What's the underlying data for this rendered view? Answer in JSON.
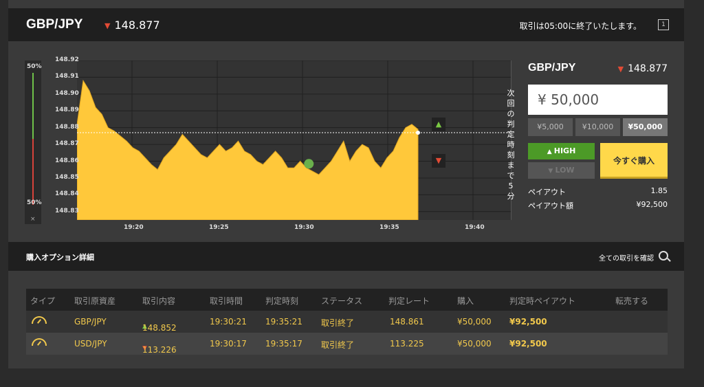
{
  "header": {
    "pair": "GBP/JPY",
    "rate": "148.877",
    "notice": "取引は05:00に終了いたします。",
    "corner_icon": "1"
  },
  "sidebar_bar": {
    "top_pct": "50%",
    "bottom_pct": "50%",
    "close": "×"
  },
  "chart_data": {
    "type": "area",
    "ylim": [
      148.825,
      148.92
    ],
    "y_ticks": [
      "148.92",
      "148.91",
      "148.90",
      "148.89",
      "148.88",
      "148.87",
      "148.86",
      "148.85",
      "148.84",
      "148.83"
    ],
    "x_ticks": [
      "19:20",
      "19:25",
      "19:30",
      "19:35",
      "19:40"
    ],
    "current_level": 148.877,
    "series": [
      {
        "values": [
          148.882,
          148.908,
          148.902,
          148.892,
          148.888,
          148.88,
          148.878,
          148.875,
          148.872,
          148.868,
          148.866,
          148.862,
          148.858,
          148.855,
          148.862,
          148.866,
          148.87,
          148.876,
          148.872,
          148.868,
          148.864,
          148.862,
          148.866,
          148.87,
          148.866,
          148.868,
          148.872,
          148.866,
          148.864,
          148.86,
          148.858,
          148.862,
          148.866,
          148.862,
          148.856,
          148.856,
          148.86,
          148.856,
          148.854,
          148.852,
          148.856,
          148.86,
          148.866,
          148.872,
          148.86,
          148.866,
          148.87,
          148.868,
          148.86,
          148.856,
          148.862,
          148.866,
          148.874,
          148.88,
          148.882,
          148.879
        ]
      }
    ],
    "side_text": "次回の判定時刻まで5分",
    "marker": {
      "x": 0.68
    }
  },
  "trade_panel": {
    "pair": "GBP/JPY",
    "rate": "148.877",
    "amount": "¥ 50,000",
    "presets": [
      "¥5,000",
      "¥10,000",
      "¥50,000"
    ],
    "selected_preset": 2,
    "high_label": "HIGH",
    "low_label": "LOW",
    "buy_label": "今すぐ購入",
    "payout_label": "ペイアウト",
    "payout_value": "1.85",
    "payout_amount_label": "ペイアウト額",
    "payout_amount_value": "¥92,500"
  },
  "section": {
    "title": "購入オプション詳細",
    "link": "全ての取引を確認"
  },
  "table": {
    "headers": [
      "タイプ",
      "取引原資産",
      "取引内容",
      "取引時間",
      "判定時刻",
      "ステータス",
      "判定レート",
      "購入",
      "判定時ペイアウト",
      "転売する"
    ],
    "rows": [
      {
        "asset": "GBP/JPY",
        "direction": "up",
        "content": "148.852",
        "time": "19:30:21",
        "judge": "19:35:21",
        "status": "取引終了",
        "rate": "148.861",
        "buy": "¥50,000",
        "payout": "¥92,500"
      },
      {
        "asset": "USD/JPY",
        "direction": "down",
        "content": "113.226",
        "time": "19:30:17",
        "judge": "19:35:17",
        "status": "取引終了",
        "rate": "113.225",
        "buy": "¥50,000",
        "payout": "¥92,500"
      }
    ]
  },
  "colors": {
    "area": "#ffc83a",
    "high": "#4c9a27",
    "low": "#555555",
    "down": "#e24b35",
    "up": "#7ac943",
    "buy": "#ffd84a"
  }
}
